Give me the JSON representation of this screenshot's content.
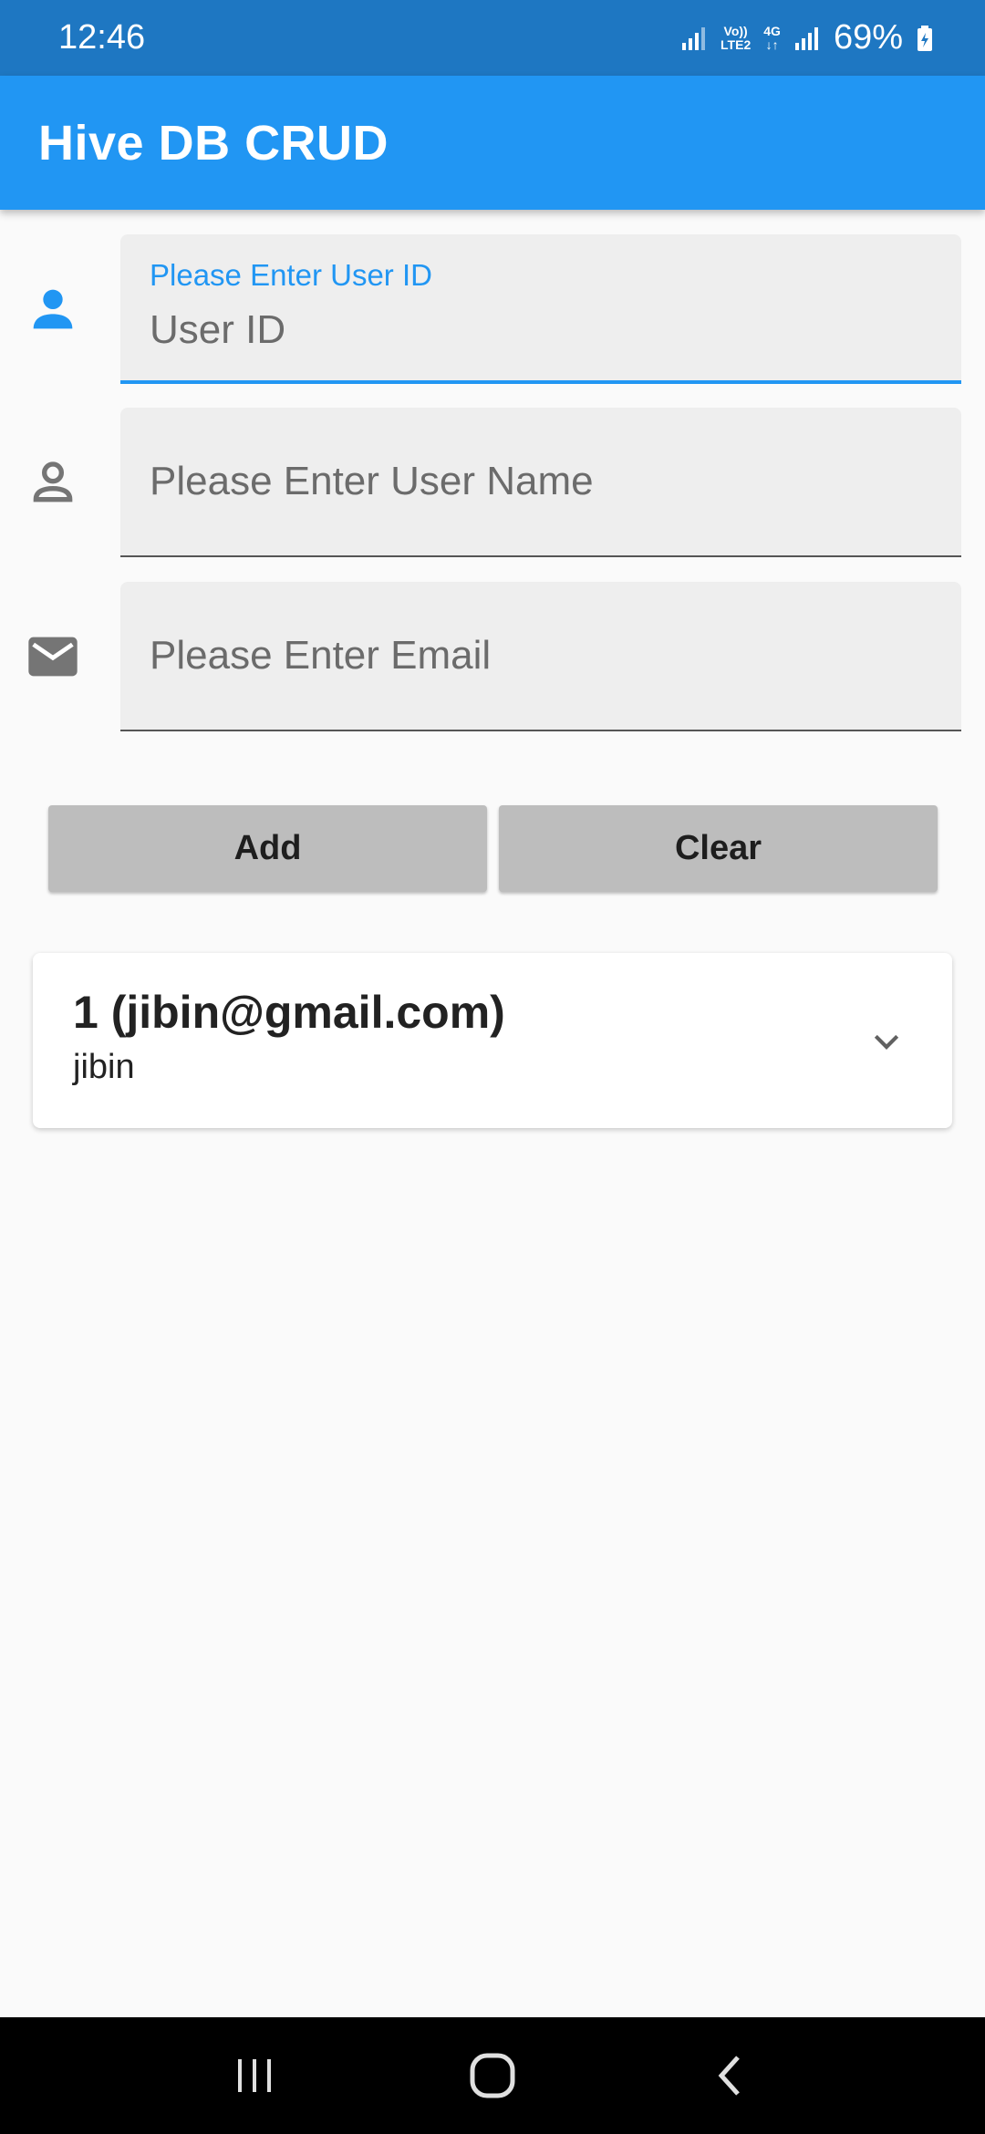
{
  "status_bar": {
    "time": "12:46",
    "network_top": "Vo))",
    "network_bottom": "LTE2",
    "network_type": "4G",
    "battery": "69%"
  },
  "app_bar": {
    "title": "Hive DB CRUD"
  },
  "form": {
    "user_id": {
      "label": "Please Enter User ID",
      "value": "User ID",
      "icon": "person-filled-icon"
    },
    "user_name": {
      "placeholder": "Please Enter User Name",
      "icon": "person-outline-icon"
    },
    "email": {
      "placeholder": "Please Enter Email",
      "icon": "mail-icon"
    }
  },
  "buttons": {
    "add": "Add",
    "clear": "Clear"
  },
  "list": {
    "items": [
      {
        "title": "1 (jibin@gmail.com)",
        "subtitle": "jibin"
      }
    ]
  },
  "colors": {
    "status_bar": "#1e77c2",
    "app_bar": "#2196f3",
    "accent": "#2196f3",
    "button": "#bdbdbd",
    "background": "#fafafa"
  }
}
